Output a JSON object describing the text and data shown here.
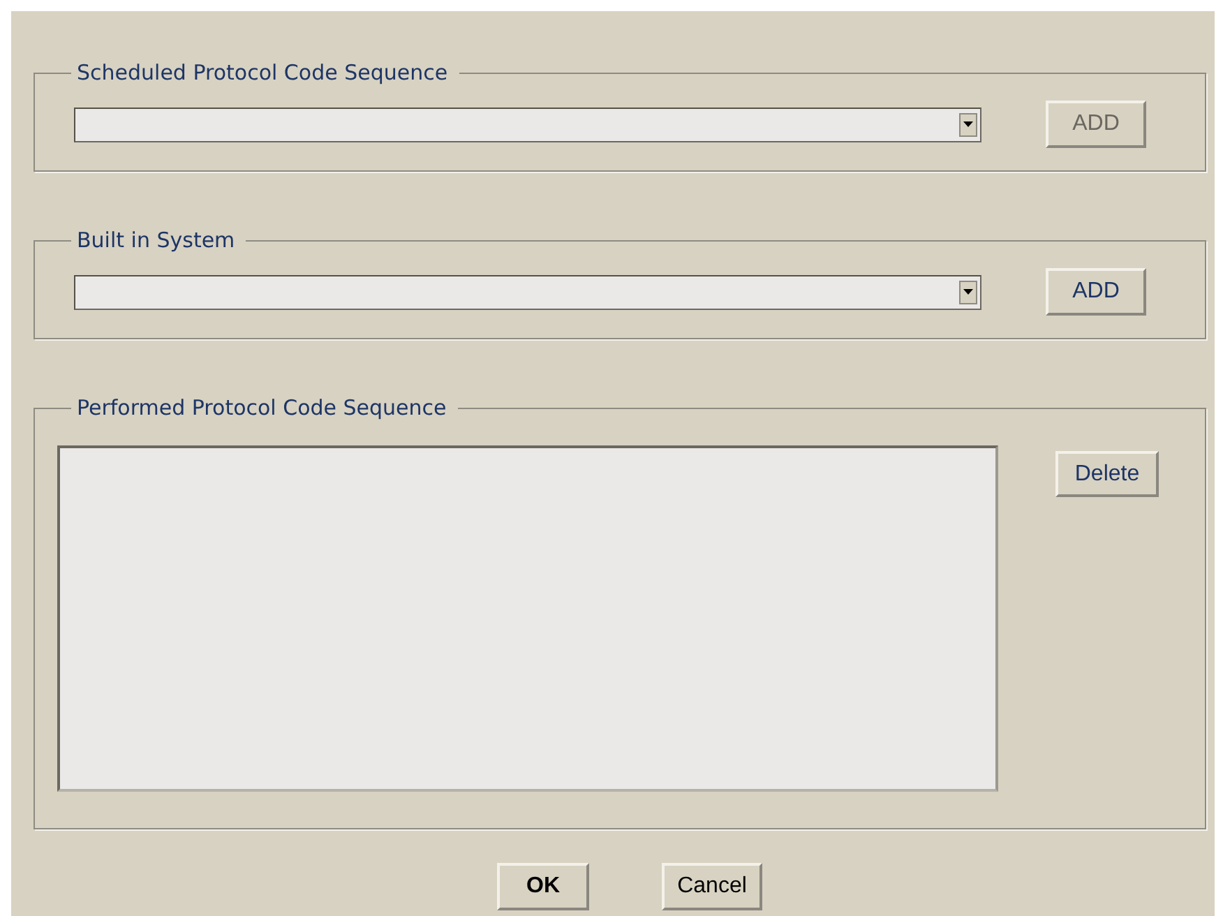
{
  "groups": [
    {
      "kind": "combo",
      "title": "Scheduled Protocol Code Sequence",
      "button": {
        "label": "ADD",
        "disabled": true
      }
    },
    {
      "kind": "combo",
      "title": "Built in System",
      "button": {
        "label": "ADD",
        "disabled": false
      }
    },
    {
      "kind": "list",
      "title": "Performed Protocol Code Sequence",
      "button": {
        "label": "Delete",
        "disabled": false
      }
    }
  ],
  "buttons": [
    "OK",
    "Cancel"
  ]
}
